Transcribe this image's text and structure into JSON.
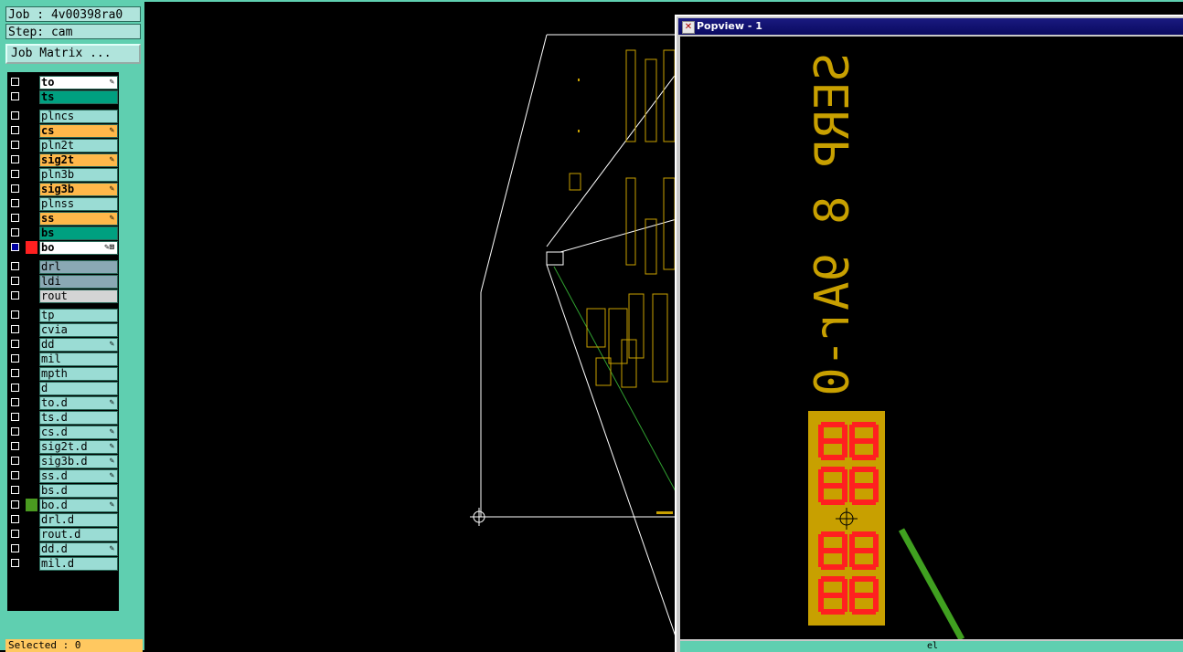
{
  "job": {
    "label": "Job : 4v00398ra0"
  },
  "step": {
    "label": "Step: cam"
  },
  "matrix_button": {
    "label": "Job Matrix ..."
  },
  "layers": [
    {
      "name": "to",
      "color": "#ffffff",
      "affected": true,
      "bright": true
    },
    {
      "name": "ts",
      "color": "#00a080",
      "affected": false,
      "bright": true
    },
    {
      "name": "plncs",
      "color": "#9adcd4",
      "affected": false,
      "bright": false
    },
    {
      "name": "cs",
      "color": "#ffb84a",
      "affected": true,
      "bright": true
    },
    {
      "name": "pln2t",
      "color": "#9adcd4",
      "affected": false,
      "bright": false
    },
    {
      "name": "sig2t",
      "color": "#ffb84a",
      "affected": true,
      "bright": true
    },
    {
      "name": "pln3b",
      "color": "#9adcd4",
      "affected": false,
      "bright": false
    },
    {
      "name": "sig3b",
      "color": "#ffb84a",
      "affected": true,
      "bright": true
    },
    {
      "name": "plnss",
      "color": "#9adcd4",
      "affected": false,
      "bright": false
    },
    {
      "name": "ss",
      "color": "#ffb84a",
      "affected": true,
      "bright": true
    },
    {
      "name": "bs",
      "color": "#00a080",
      "affected": false,
      "bright": true
    },
    {
      "name": "bo",
      "color": "#ffffff",
      "affected": true,
      "bright": true,
      "work": true
    },
    {
      "name": "drl",
      "color": "#8aa8b4",
      "affected": false,
      "bright": false
    },
    {
      "name": "ldi",
      "color": "#8aa8b4",
      "affected": false,
      "bright": false
    },
    {
      "name": "rout",
      "color": "#d4d4d4",
      "affected": false,
      "bright": false
    },
    {
      "name": "tp",
      "color": "#9adcd4",
      "affected": false,
      "bright": false
    },
    {
      "name": "cvia",
      "color": "#9adcd4",
      "affected": false,
      "bright": false
    },
    {
      "name": "dd",
      "color": "#9adcd4",
      "affected": true,
      "bright": false
    },
    {
      "name": "mil",
      "color": "#9adcd4",
      "affected": false,
      "bright": false
    },
    {
      "name": "mpth",
      "color": "#9adcd4",
      "affected": false,
      "bright": false
    },
    {
      "name": "d",
      "color": "#9adcd4",
      "affected": false,
      "bright": false
    },
    {
      "name": "to.d",
      "color": "#9adcd4",
      "affected": true,
      "bright": false
    },
    {
      "name": "ts.d",
      "color": "#9adcd4",
      "affected": false,
      "bright": false
    },
    {
      "name": "cs.d",
      "color": "#9adcd4",
      "affected": true,
      "bright": false
    },
    {
      "name": "sig2t.d",
      "color": "#9adcd4",
      "affected": true,
      "bright": false
    },
    {
      "name": "sig3b.d",
      "color": "#9adcd4",
      "affected": true,
      "bright": false
    },
    {
      "name": "ss.d",
      "color": "#9adcd4",
      "affected": true,
      "bright": false
    },
    {
      "name": "bs.d",
      "color": "#9adcd4",
      "affected": false,
      "bright": false
    },
    {
      "name": "bo.d",
      "color": "#9adcd4",
      "affected": true,
      "bright": false,
      "display": "#4a9a20"
    },
    {
      "name": "drl.d",
      "color": "#9adcd4",
      "affected": false,
      "bright": false
    },
    {
      "name": "rout.d",
      "color": "#9adcd4",
      "affected": false,
      "bright": false
    },
    {
      "name": "dd.d",
      "color": "#9adcd4",
      "affected": true,
      "bright": false
    },
    {
      "name": "mil.d",
      "color": "#9adcd4",
      "affected": false,
      "bright": false
    }
  ],
  "selected": {
    "label": "Selected : 0"
  },
  "popview": {
    "title": "Popview - 1",
    "text_mirrored": "SERP 8 9Ar-0",
    "bottom_label": "el"
  },
  "colors": {
    "accent": "#5fcfb0",
    "copper": "#c8a000",
    "feature": "#ff2020",
    "route": "#40a020"
  }
}
